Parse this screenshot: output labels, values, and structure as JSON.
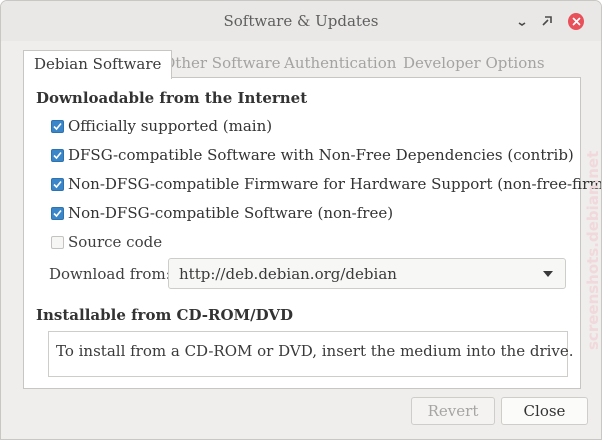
{
  "window": {
    "title": "Software & Updates"
  },
  "tabs": [
    {
      "label": "Debian Software",
      "active": true
    },
    {
      "label": "Other Software",
      "active": false
    },
    {
      "label": "Authentication",
      "active": false
    },
    {
      "label": "Developer Options",
      "active": false
    }
  ],
  "internet": {
    "heading": "Downloadable from the Internet",
    "options": [
      {
        "label": "Officially supported (main)",
        "checked": true
      },
      {
        "label": "DFSG-compatible Software with Non-Free Dependencies (contrib)",
        "checked": true
      },
      {
        "label": "Non-DFSG-compatible Firmware for Hardware Support (non-free-firmware)",
        "checked": true
      },
      {
        "label": "Non-DFSG-compatible Software (non-free)",
        "checked": true
      },
      {
        "label": "Source code",
        "checked": false
      }
    ],
    "download_from_label": "Download from:",
    "download_from_value": "http://deb.debian.org/debian"
  },
  "cdrom": {
    "heading": "Installable from CD-ROM/DVD",
    "info": "To install from a CD-ROM or DVD, insert the medium into the drive."
  },
  "buttons": {
    "revert": "Revert",
    "close": "Close"
  },
  "watermark": {
    "text": "screenshots.debian.net"
  },
  "colors": {
    "accent": "#3a86c9",
    "close_button": "#e8505a",
    "window_bg": "#efeeec"
  }
}
